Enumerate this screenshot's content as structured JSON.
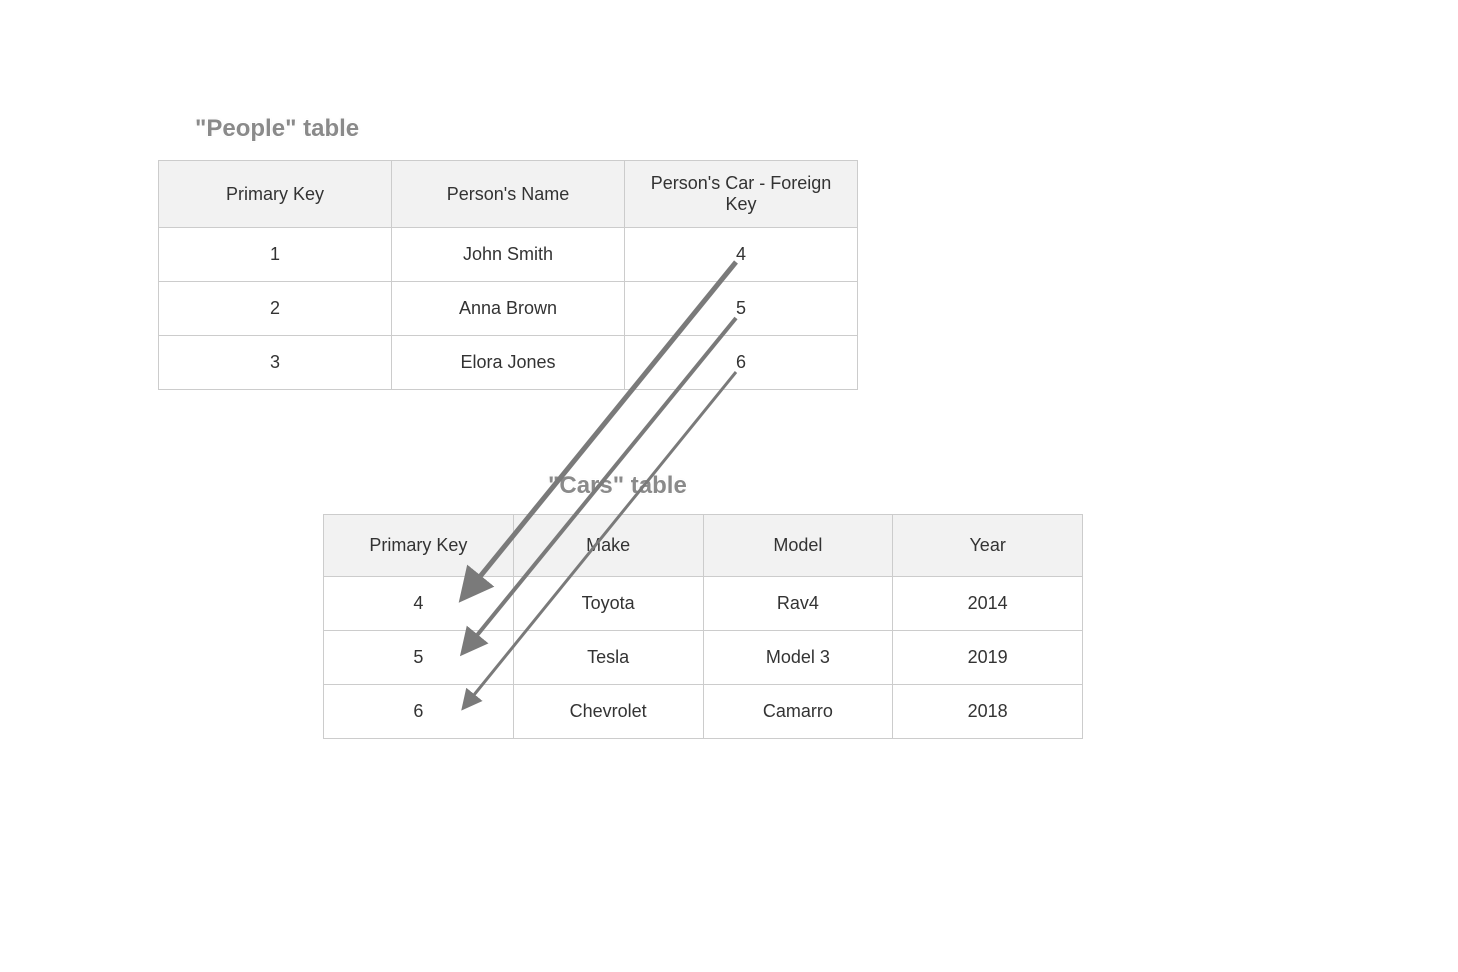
{
  "people": {
    "title": "\"People\" table",
    "headers": {
      "pk": "Primary Key",
      "name": "Person's Name",
      "car_fk": "Person's Car - Foreign Key"
    },
    "rows": [
      {
        "pk": "1",
        "name": "John Smith",
        "car_fk": "4"
      },
      {
        "pk": "2",
        "name": "Anna Brown",
        "car_fk": "5"
      },
      {
        "pk": "3",
        "name": "Elora Jones",
        "car_fk": "6"
      }
    ]
  },
  "cars": {
    "title": "\"Cars\" table",
    "headers": {
      "pk": "Primary Key",
      "make": "Make",
      "model": "Model",
      "year": "Year"
    },
    "rows": [
      {
        "pk": "4",
        "make": "Toyota",
        "model": "Rav4",
        "year": "2014"
      },
      {
        "pk": "5",
        "make": "Tesla",
        "model": "Model 3",
        "year": "2019"
      },
      {
        "pk": "6",
        "make": "Chevrolet",
        "model": "Camarro",
        "year": "2018"
      }
    ]
  }
}
